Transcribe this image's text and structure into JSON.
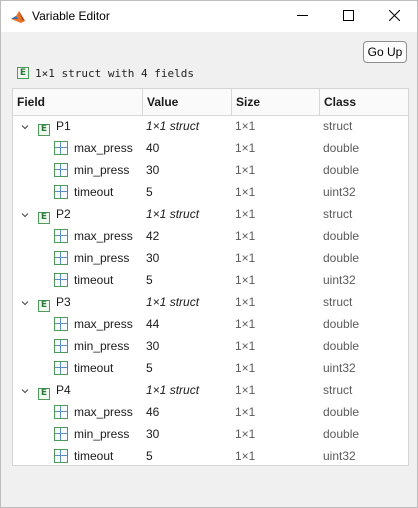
{
  "window": {
    "title": "Variable Editor",
    "icons": {
      "app": "matlab-logo-icon",
      "minimize": "minimize-icon",
      "maximize": "maximize-icon",
      "close": "close-icon"
    }
  },
  "toolbar": {
    "go_up_label": "Go Up"
  },
  "summary": {
    "icon": "struct-icon",
    "text": "1×1 struct with 4 fields"
  },
  "table": {
    "columns": [
      "Field",
      "Value",
      "Size",
      "Class"
    ],
    "rows": [
      {
        "level": 0,
        "expanded": true,
        "name": "P1",
        "value": "1×1 struct",
        "size": "1×1",
        "class": "struct"
      },
      {
        "level": 1,
        "name": "max_press",
        "value": "40",
        "size": "1×1",
        "class": "double"
      },
      {
        "level": 1,
        "name": "min_press",
        "value": "30",
        "size": "1×1",
        "class": "double"
      },
      {
        "level": 1,
        "name": "timeout",
        "value": "5",
        "size": "1×1",
        "class": "uint32"
      },
      {
        "level": 0,
        "expanded": true,
        "name": "P2",
        "value": "1×1 struct",
        "size": "1×1",
        "class": "struct"
      },
      {
        "level": 1,
        "name": "max_press",
        "value": "42",
        "size": "1×1",
        "class": "double"
      },
      {
        "level": 1,
        "name": "min_press",
        "value": "30",
        "size": "1×1",
        "class": "double"
      },
      {
        "level": 1,
        "name": "timeout",
        "value": "5",
        "size": "1×1",
        "class": "uint32"
      },
      {
        "level": 0,
        "expanded": true,
        "name": "P3",
        "value": "1×1 struct",
        "size": "1×1",
        "class": "struct"
      },
      {
        "level": 1,
        "name": "max_press",
        "value": "44",
        "size": "1×1",
        "class": "double"
      },
      {
        "level": 1,
        "name": "min_press",
        "value": "30",
        "size": "1×1",
        "class": "double"
      },
      {
        "level": 1,
        "name": "timeout",
        "value": "5",
        "size": "1×1",
        "class": "uint32"
      },
      {
        "level": 0,
        "expanded": true,
        "name": "P4",
        "value": "1×1 struct",
        "size": "1×1",
        "class": "struct"
      },
      {
        "level": 1,
        "name": "max_press",
        "value": "46",
        "size": "1×1",
        "class": "double"
      },
      {
        "level": 1,
        "name": "min_press",
        "value": "30",
        "size": "1×1",
        "class": "double"
      },
      {
        "level": 1,
        "name": "timeout",
        "value": "5",
        "size": "1×1",
        "class": "uint32"
      }
    ]
  }
}
